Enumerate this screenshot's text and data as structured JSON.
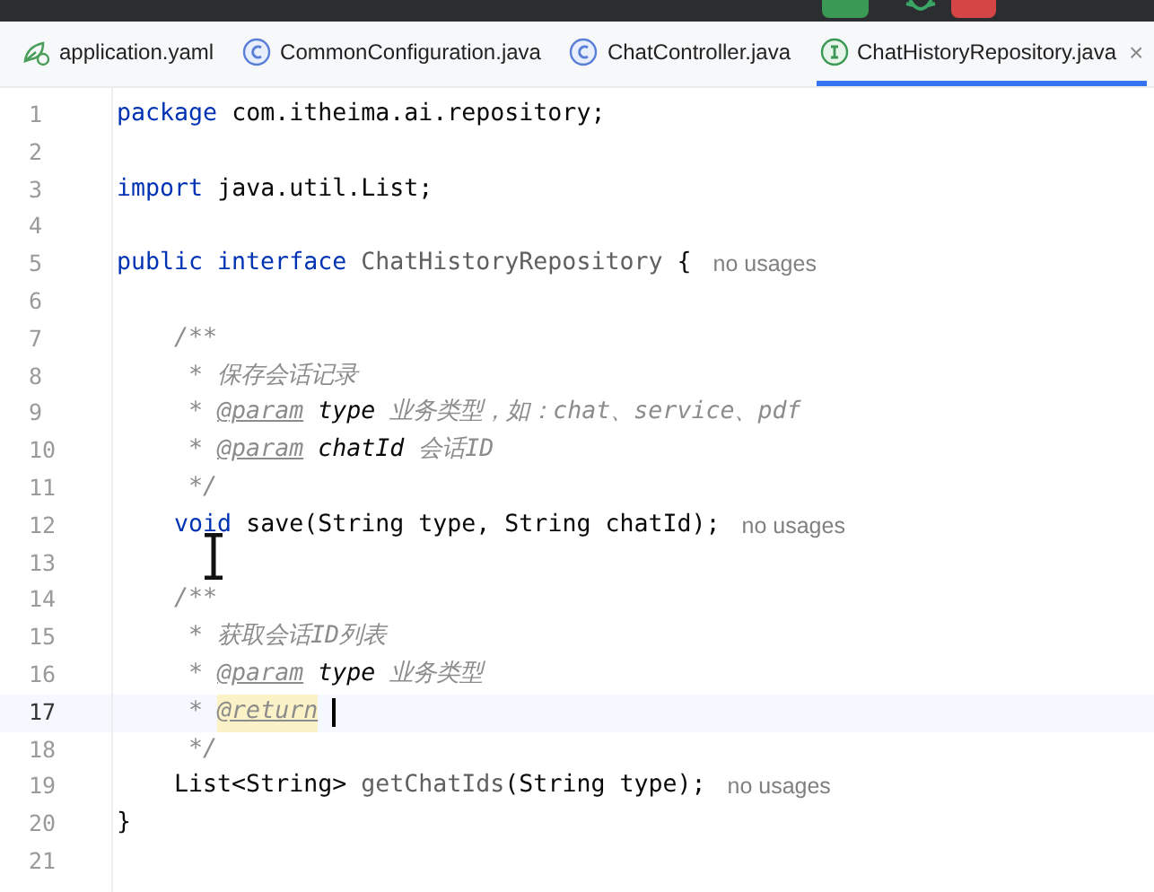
{
  "tabs": [
    {
      "label": "application.yaml",
      "kind": "yaml",
      "selected": false
    },
    {
      "label": "CommonConfiguration.java",
      "kind": "class",
      "selected": false
    },
    {
      "label": "ChatController.java",
      "kind": "class",
      "selected": false
    },
    {
      "label": "ChatHistoryRepository.java",
      "kind": "interface",
      "selected": true,
      "close": "×"
    }
  ],
  "editor": {
    "lines": [
      {
        "number": "1",
        "current": false,
        "tokens": [
          {
            "kind": "kw",
            "text": "package"
          },
          {
            "kind": "plain",
            "text": " com.itheima.ai.repository;"
          }
        ]
      },
      {
        "number": "2",
        "current": false
      },
      {
        "number": "3",
        "current": false,
        "tokens": [
          {
            "kind": "kw",
            "text": "import"
          },
          {
            "kind": "plain",
            "text": " java.util.List;"
          }
        ]
      },
      {
        "number": "4",
        "current": false
      },
      {
        "number": "5",
        "current": false,
        "tokens": [
          {
            "kind": "kw",
            "text": "public interface"
          },
          {
            "kind": "unused",
            "text": " ChatHistoryRepository"
          },
          {
            "kind": "plain",
            "text": " {"
          },
          {
            "kind": "hint",
            "text": "no usages"
          }
        ]
      },
      {
        "number": "6",
        "current": false
      },
      {
        "number": "7",
        "current": false,
        "tokens": [
          {
            "kind": "comment",
            "text": "    /**"
          }
        ]
      },
      {
        "number": "8",
        "current": false,
        "tokens": [
          {
            "kind": "comment",
            "text": "     * 保存会话记录"
          }
        ]
      },
      {
        "number": "9",
        "current": false,
        "tokens": [
          {
            "kind": "comment",
            "text": "     * "
          },
          {
            "kind": "tag",
            "text": "@param"
          },
          {
            "kind": "param",
            "text": " type"
          },
          {
            "kind": "comment",
            "text": " 业务类型，如：chat、service、pdf"
          }
        ]
      },
      {
        "number": "10",
        "current": false,
        "tokens": [
          {
            "kind": "comment",
            "text": "     * "
          },
          {
            "kind": "tag",
            "text": "@param"
          },
          {
            "kind": "param",
            "text": " chatId"
          },
          {
            "kind": "comment",
            "text": " 会话ID"
          }
        ]
      },
      {
        "number": "11",
        "current": false,
        "tokens": [
          {
            "kind": "comment",
            "text": "     */"
          }
        ]
      },
      {
        "number": "12",
        "current": false,
        "tokens": [
          {
            "kind": "kw",
            "text": "    void"
          },
          {
            "kind": "plain",
            "text": " save(String type, String chatId);"
          },
          {
            "kind": "hint",
            "text": "no usages"
          }
        ]
      },
      {
        "number": "13",
        "current": false
      },
      {
        "number": "14",
        "current": false,
        "tokens": [
          {
            "kind": "comment",
            "text": "    /**"
          }
        ]
      },
      {
        "number": "15",
        "current": false,
        "tokens": [
          {
            "kind": "comment",
            "text": "     * 获取会话ID列表"
          }
        ]
      },
      {
        "number": "16",
        "current": false,
        "tokens": [
          {
            "kind": "comment",
            "text": "     * "
          },
          {
            "kind": "tag",
            "text": "@param"
          },
          {
            "kind": "param",
            "text": " type"
          },
          {
            "kind": "comment",
            "text": " 业务类型"
          }
        ]
      },
      {
        "number": "17",
        "current": true,
        "tokens": [
          {
            "kind": "comment",
            "text": "     * "
          },
          {
            "kind": "tagmatch",
            "text": "@return"
          }
        ]
      },
      {
        "number": "18",
        "current": false,
        "tokens": [
          {
            "kind": "comment",
            "text": "     */"
          }
        ]
      },
      {
        "number": "19",
        "current": false,
        "tokens": [
          {
            "kind": "plain",
            "text": "    List<String> "
          },
          {
            "kind": "unused",
            "text": "getChatIds"
          },
          {
            "kind": "plain",
            "text": "(String type);"
          },
          {
            "kind": "hint",
            "text": "no usages"
          }
        ]
      },
      {
        "number": "20",
        "current": false,
        "tokens": [
          {
            "kind": "plain",
            "text": "}"
          }
        ]
      },
      {
        "number": "21",
        "current": false
      }
    ]
  }
}
